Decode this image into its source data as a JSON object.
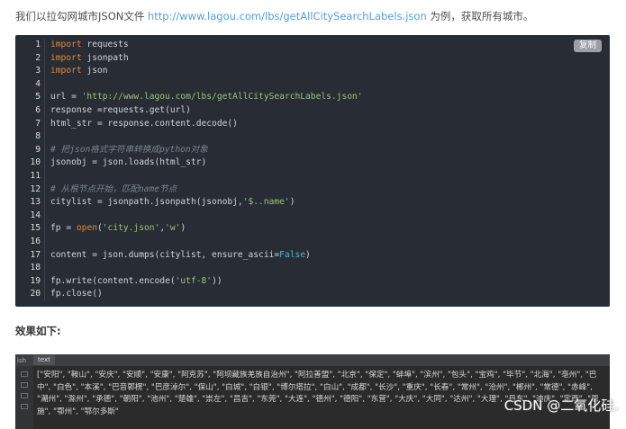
{
  "intro": {
    "before": "我们以拉勾网城市JSON文件 ",
    "link": "http://www.lagou.com/lbs/getAllCitySearchLabels.json",
    "after": " 为例，获取所有城市。"
  },
  "code_block": {
    "copy_label": "复制",
    "lines": [
      {
        "n": "1",
        "segs": [
          {
            "t": "import",
            "c": "kw"
          },
          {
            "t": " requests",
            "c": ""
          }
        ]
      },
      {
        "n": "2",
        "segs": [
          {
            "t": "import",
            "c": "kw"
          },
          {
            "t": " jsonpath",
            "c": ""
          }
        ]
      },
      {
        "n": "3",
        "segs": [
          {
            "t": "import",
            "c": "kw"
          },
          {
            "t": " json",
            "c": ""
          }
        ]
      },
      {
        "n": "4",
        "segs": []
      },
      {
        "n": "5",
        "segs": [
          {
            "t": "url = ",
            "c": ""
          },
          {
            "t": "'http://www.lagou.com/lbs/getAllCitySearchLabels.json'",
            "c": "str"
          }
        ]
      },
      {
        "n": "6",
        "segs": [
          {
            "t": "response =requests.get(url)",
            "c": ""
          }
        ]
      },
      {
        "n": "7",
        "segs": [
          {
            "t": "html_str = response.content.decode()",
            "c": ""
          }
        ]
      },
      {
        "n": "8",
        "segs": []
      },
      {
        "n": "9",
        "segs": [
          {
            "t": "# 把json格式字符串转换成python对象",
            "c": "cmt"
          }
        ]
      },
      {
        "n": "10",
        "segs": [
          {
            "t": "jsonobj = json.loads(html_str)",
            "c": ""
          }
        ]
      },
      {
        "n": "11",
        "segs": []
      },
      {
        "n": "12",
        "segs": [
          {
            "t": "# 从根节点开始，匹配name节点",
            "c": "cmt"
          }
        ]
      },
      {
        "n": "13",
        "segs": [
          {
            "t": "citylist = jsonpath.jsonpath(jsonobj,",
            "c": ""
          },
          {
            "t": "'$..name'",
            "c": "str"
          },
          {
            "t": ")",
            "c": ""
          }
        ]
      },
      {
        "n": "14",
        "segs": []
      },
      {
        "n": "15",
        "segs": [
          {
            "t": "fp = ",
            "c": ""
          },
          {
            "t": "open",
            "c": "kw"
          },
          {
            "t": "(",
            "c": ""
          },
          {
            "t": "'city.json'",
            "c": "str"
          },
          {
            "t": ",",
            "c": ""
          },
          {
            "t": "'w'",
            "c": "str"
          },
          {
            "t": ")",
            "c": ""
          }
        ]
      },
      {
        "n": "16",
        "segs": []
      },
      {
        "n": "17",
        "segs": [
          {
            "t": "content = json.dumps(citylist, ensure_ascii=",
            "c": ""
          },
          {
            "t": "False",
            "c": "bool"
          },
          {
            "t": ")",
            "c": ""
          }
        ]
      },
      {
        "n": "18",
        "segs": []
      },
      {
        "n": "19",
        "segs": [
          {
            "t": "fp.write(content.encode(",
            "c": ""
          },
          {
            "t": "'utf-8'",
            "c": "str"
          },
          {
            "t": "))",
            "c": ""
          }
        ]
      },
      {
        "n": "20",
        "segs": [
          {
            "t": "fp.close()",
            "c": ""
          }
        ]
      }
    ]
  },
  "subhead": "效果如下:",
  "result": {
    "tab_left": "ish",
    "tab_label": "text",
    "text": "[\"安阳\", \"鞍山\", \"安庆\", \"安顺\", \"安康\", \"阿克苏\", \"阿坝藏族羌族自治州\", \"阿拉善盟\", \"北京\", \"保定\", \"蚌埠\", \"滨州\", \"包头\", \"宝鸡\", \"毕节\", \"北海\", \"亳州\", \"巴中\", \"白色\", \"本溪\", \"巴音郭楞\", \"巴彦淖尔\", \"保山\", \"白城\", \"白银\", \"博尔塔拉\", \"白山\", \"成都\", \"长沙\", \"重庆\", \"长春\", \"常州\", \"沧州\", \"郴州\", \"常德\", \"赤峰\", \"潮州\", \"滁州\", \"承德\", \"朝阳\", \"池州\", \"楚雄\", \"崇左\", \"昌吉\", \"东莞\", \"大连\", \"德州\", \"德阳\", \"东营\", \"大庆\", \"大同\", \"达州\", \"大理\", \"丹东\", \"迪庆\", \"定西\", \"恩施\", \"鄂州\", \"鄂尔多斯\""
  },
  "watermark": "CSDN @二氧化硅."
}
